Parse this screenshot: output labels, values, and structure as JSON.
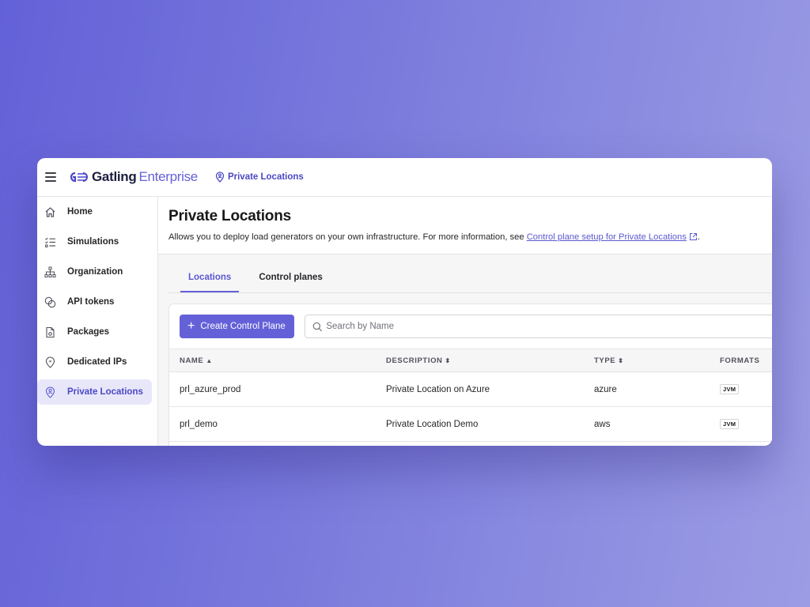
{
  "app": {
    "brand_primary": "Gatling",
    "brand_secondary": "Enterprise",
    "accent_color": "#6461d8"
  },
  "breadcrumb": {
    "icon": "location-pin-icon",
    "label": "Private Locations"
  },
  "sidebar": {
    "items": [
      {
        "label": "Home",
        "icon": "home-icon",
        "active": false
      },
      {
        "label": "Simulations",
        "icon": "checklist-icon",
        "active": false
      },
      {
        "label": "Organization",
        "icon": "org-chart-icon",
        "active": false
      },
      {
        "label": "API tokens",
        "icon": "tokens-icon",
        "active": false
      },
      {
        "label": "Packages",
        "icon": "package-file-icon",
        "active": false
      },
      {
        "label": "Dedicated IPs",
        "icon": "ip-pin-icon",
        "active": false
      },
      {
        "label": "Private Locations",
        "icon": "location-pin-icon",
        "active": true
      }
    ]
  },
  "page": {
    "title": "Private Locations",
    "description": "Allows you to deploy load generators on your own infrastructure. For more information, see ",
    "link_text": "Control plane setup for Private Locations",
    "description_end": "."
  },
  "tabs": [
    {
      "label": "Locations",
      "active": true
    },
    {
      "label": "Control planes",
      "active": false
    }
  ],
  "toolbar": {
    "create_button": "Create Control Plane",
    "search_placeholder": "Search by Name",
    "search_value": ""
  },
  "table": {
    "columns": [
      {
        "label": "NAME",
        "sort": "asc"
      },
      {
        "label": "DESCRIPTION",
        "sort": "both"
      },
      {
        "label": "TYPE",
        "sort": "both"
      },
      {
        "label": "FORMATS",
        "sort": "none"
      }
    ],
    "rows": [
      {
        "name": "prl_azure_prod",
        "description": "Private Location on Azure",
        "type": "azure",
        "format": "JVM"
      },
      {
        "name": "prl_demo",
        "description": "Private Location Demo",
        "type": "aws",
        "format": "JVM"
      }
    ]
  }
}
